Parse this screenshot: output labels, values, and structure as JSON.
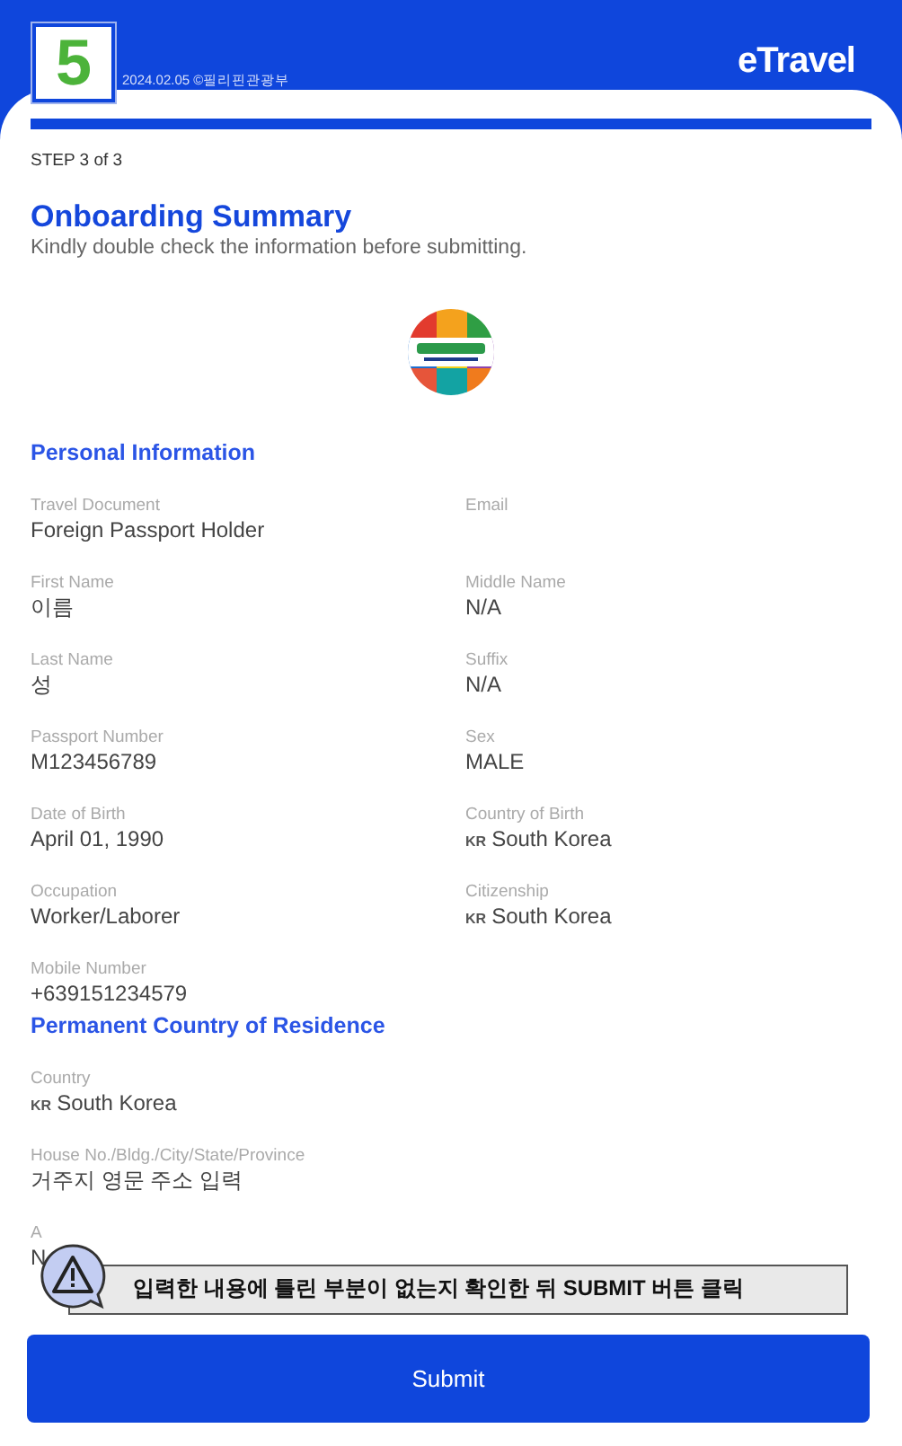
{
  "header": {
    "step_badge": "5",
    "date": "2024.02.05 ©필리핀관광부",
    "logo": "eTravel"
  },
  "progress": {
    "level": 1
  },
  "step": "STEP 3 of 3",
  "title": "Onboarding Summary",
  "subtitle": "Kindly double check the information before submitting.",
  "sections": [
    {
      "title": "Personal Information",
      "fields": [
        {
          "label": "Travel Document",
          "value": "Foreign Passport Holder"
        },
        {
          "label": "Email"
        },
        {
          "label": "First Name",
          "value": "이름"
        },
        {
          "label": "Middle Name",
          "value": "N/A"
        },
        {
          "label": "Last Name",
          "value": "성"
        },
        {
          "label": "Suffix",
          "value": "N/A"
        },
        {
          "label": "Passport Number",
          "value": "M123456789"
        },
        {
          "label": "Sex",
          "value": "MALE"
        },
        {
          "label": "Date of Birth",
          "value": "April 01, 1990"
        },
        {
          "label": "Country of Birth",
          "flag": "KR",
          "value": "South Korea"
        },
        {
          "label": "Occupation",
          "value": "Worker/Laborer"
        },
        {
          "label": "Citizenship",
          "flag": "KR",
          "value": "South Korea"
        },
        {
          "label": "Mobile Number",
          "value": "+639151234579"
        }
      ]
    },
    {
      "title": "Permanent Country of Residence",
      "fields": [
        {
          "label": "Country",
          "flag": "KR",
          "value": "South Korea"
        },
        {
          "label": "House No./Bldg./City/State/Province",
          "value": "거주지 영문 주소 입력"
        },
        {
          "label": "A",
          "value": "N"
        }
      ]
    }
  ],
  "callout": {
    "text": "입력한 내용에 틀린 부분이 없는지 확인한 뒤 SUBMIT 버튼 클릭"
  },
  "submit": "Submit"
}
